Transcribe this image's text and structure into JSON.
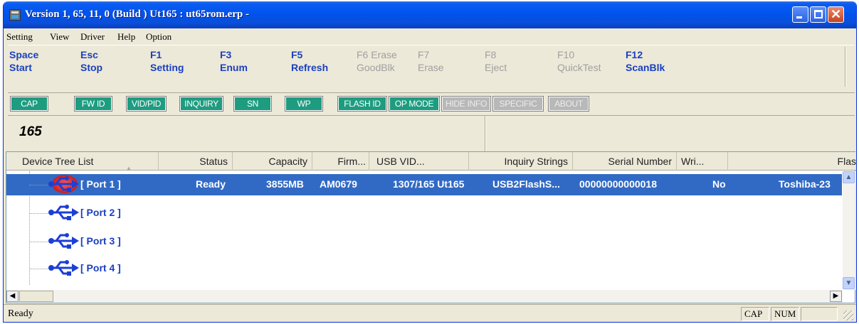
{
  "window": {
    "title": "Version 1, 65, 11, 0 (Build ) Ut165 : ut65rom.erp  -"
  },
  "menu": [
    "Setting",
    "View",
    "Driver",
    "Help",
    "Option"
  ],
  "fkeys": [
    {
      "key": "Space",
      "label": "Start",
      "enabled": true
    },
    {
      "key": "Esc",
      "label": "Stop",
      "enabled": true
    },
    {
      "key": "F1",
      "label": "Setting",
      "enabled": true
    },
    {
      "key": "F3",
      "label": "Enum",
      "enabled": true
    },
    {
      "key": "F5",
      "label": "Refresh",
      "enabled": true
    },
    {
      "key": "F6 Erase",
      "label": "GoodBlk",
      "enabled": false
    },
    {
      "key": "F7",
      "label": "Erase",
      "enabled": false
    },
    {
      "key": "F8",
      "label": "Eject",
      "enabled": false
    },
    {
      "key": "F10",
      "label": "QuickTest",
      "enabled": false
    },
    {
      "key": "F12",
      "label": "ScanBlk",
      "enabled": true
    }
  ],
  "tabs": [
    {
      "label": "CAP",
      "enabled": true
    },
    {
      "label": "FW ID",
      "enabled": true
    },
    {
      "label": "VID/PID",
      "enabled": true
    },
    {
      "label": "INQUIRY",
      "enabled": true
    },
    {
      "label": "SN",
      "enabled": true
    },
    {
      "label": "WP",
      "enabled": true
    },
    {
      "label": "FLASH ID",
      "enabled": true
    },
    {
      "label": "OP MODE",
      "enabled": true
    },
    {
      "label": "HIDE INFO",
      "enabled": false
    },
    {
      "label": "SPECIFIC",
      "enabled": false
    },
    {
      "label": "ABOUT",
      "enabled": false
    }
  ],
  "info": {
    "model": "165"
  },
  "list": {
    "columns": [
      "Device Tree List",
      "Status",
      "Capacity",
      "Firm...",
      "USB VID...",
      "Inquiry Strings",
      "Serial Number",
      "Wri...",
      "Flas"
    ],
    "rows": [
      {
        "port": "[ Port  1 ]",
        "status": "Ready",
        "capacity": "3855MB",
        "firmware": "AM0679",
        "usb_vid": "1307/165  Ut165",
        "inquiry": "USB2FlashS...",
        "serial": "00000000000018",
        "write_protect": "No",
        "flash": "Toshiba-23",
        "selected": true
      },
      {
        "port": "[ Port  2 ]"
      },
      {
        "port": "[ Port  3 ]"
      },
      {
        "port": "[ Port  4 ]"
      }
    ]
  },
  "status": {
    "text": "Ready",
    "cap": "CAP",
    "num": "NUM"
  },
  "colors": {
    "selection": "#316ac5",
    "accent_text": "#1a3fbf",
    "tab_on": "#1e9c80",
    "tab_off": "#b8b8b8"
  }
}
